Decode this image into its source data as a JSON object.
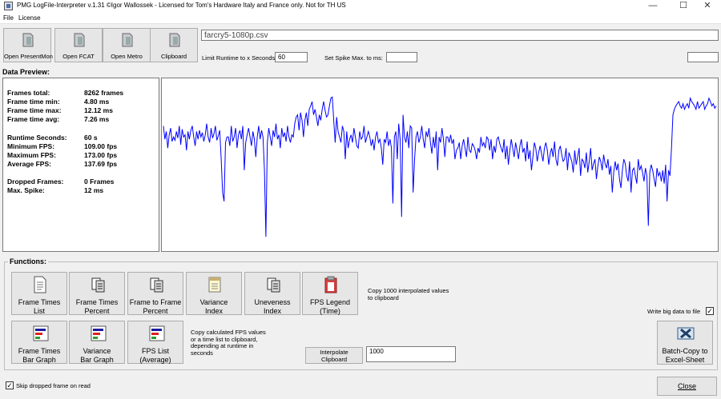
{
  "window": {
    "title": "PMG LogFile-Interpreter v.1.31 ©Igor Wallossek - Licensed for Tom's Hardware Italy and France only. Not for TH US",
    "minimize_glyph": "—",
    "maximize_glyph": "☐",
    "close_glyph": "✕"
  },
  "menu": {
    "file": "File",
    "license": "License"
  },
  "toolbar": {
    "open_presentmon": "Open PresentMon",
    "open_fcat": "Open FCAT",
    "open_metro": "Open Metro",
    "clipboard": "Clipboard"
  },
  "filename": "farcry5-1080p.csv",
  "limit_runtime": {
    "label": "Limit Runtime to x Seconds:",
    "value": "60"
  },
  "spike": {
    "label": "Set Spike Max. to ms:",
    "value": ""
  },
  "extra_field": "",
  "preview_label": "Data Preview:",
  "stats": {
    "frames_total_label": "Frames total:",
    "frames_total": "8262 frames",
    "ft_min_label": "Frame time min:",
    "ft_min": "4.80 ms",
    "ft_max_label": "Frame time max:",
    "ft_max": "12.12 ms",
    "ft_avg_label": "Frame time avg:",
    "ft_avg": "7.26 ms",
    "runtime_label": "Runtime Seconds:",
    "runtime": "60 s",
    "min_fps_label": "Minimum FPS:",
    "min_fps": "109.00 fps",
    "max_fps_label": "Maximum FPS:",
    "max_fps": "173.00 fps",
    "avg_fps_label": "Average FPS:",
    "avg_fps": "137.69 fps",
    "dropped_label": "Dropped Frames:",
    "dropped": "0 Frames",
    "spike_label": "Max. Spike:",
    "spike": "12 ms"
  },
  "functions": {
    "group_label": "Functions:",
    "frame_times_list": [
      "Frame Times",
      "List"
    ],
    "frame_times_percent": [
      "Frame Times",
      "Percent"
    ],
    "frame_to_frame_percent": [
      "Frame to Frame",
      "Percent"
    ],
    "variance_index": [
      "Variance",
      "Index"
    ],
    "uneveness_index": [
      "Uneveness",
      "Index"
    ],
    "fps_legend": [
      "FPS Legend",
      "(Time)"
    ],
    "frame_times_bar": [
      "Frame Times",
      "Bar Graph"
    ],
    "variance_bar": [
      "Variance",
      "Bar Graph"
    ],
    "fps_list_avg": [
      "FPS List",
      "(Average)"
    ],
    "copy_1000_note": [
      "Copy 1000 interpolated values",
      "to clipboard"
    ],
    "copy_calc_note": [
      "Copy calculated FPS values",
      "or a time list to clipboard,",
      "depending at runtime in",
      "seconds"
    ],
    "interpolate": [
      "Interpolate",
      "Clipboard"
    ],
    "interpolate_value": "1000",
    "write_big_label": "Write big data to file",
    "write_big_checked": "✓",
    "batch_copy": [
      "Batch-Copy to",
      "Excel-Sheet"
    ]
  },
  "skip_dropped": {
    "label": "Skip dropped frame on read",
    "checked": "✓"
  },
  "close": "Close",
  "colors": {
    "trace": "#0000ff",
    "red": "#e02020",
    "blue": "#1a1aa0",
    "green": "#2aa02a"
  },
  "chart_data": {
    "type": "line",
    "title": "",
    "series": [
      {
        "values": [
          160,
          148,
          155,
          140,
          152,
          158,
          146,
          150,
          147,
          155,
          149,
          160,
          143,
          157,
          150,
          152,
          138,
          155,
          148,
          156,
          160,
          150,
          142,
          155,
          148,
          156,
          150,
          154,
          146,
          152,
          162,
          150,
          145,
          158,
          149,
          153,
          160,
          147,
          151,
          156,
          130,
          100,
          92,
          145,
          150,
          150,
          142,
          160,
          146,
          150,
          158,
          140,
          152,
          156,
          148,
          160,
          120,
          145,
          152,
          158,
          150,
          142,
          155,
          148,
          132,
          150,
          160,
          148,
          156,
          150,
          120,
          60,
          145,
          158,
          150,
          142,
          156,
          150,
          162,
          148,
          152,
          140,
          158,
          150,
          154,
          146,
          160,
          150,
          145,
          152,
          150,
          162,
          168,
          170,
          156,
          172,
          165,
          150,
          165,
          172,
          160,
          175,
          178,
          182,
          170,
          175,
          168,
          160,
          170,
          165,
          175,
          182,
          174,
          168,
          170,
          178,
          185,
          186,
          165,
          145,
          168,
          155,
          150,
          145,
          160,
          155,
          130,
          155,
          140,
          148,
          152,
          145,
          158,
          150,
          142,
          140,
          155,
          148,
          150,
          160,
          145,
          150,
          155,
          150,
          142,
          148,
          138,
          150,
          155,
          145,
          148,
          140,
          125,
          148,
          145,
          155,
          142,
          148,
          140,
          90,
          150,
          155,
          130,
          162,
          148,
          78,
          170,
          150,
          145,
          155,
          140,
          160,
          158,
          100,
          130,
          150,
          155,
          145,
          150,
          160,
          148,
          140,
          155,
          150,
          158,
          145,
          135,
          150,
          140,
          155,
          120,
          150,
          145,
          158,
          148,
          132,
          150,
          150,
          145,
          152,
          144,
          148,
          130,
          138,
          140,
          145,
          130,
          142,
          148,
          140,
          132,
          150,
          138,
          136,
          144,
          142,
          138,
          130,
          140,
          136,
          150,
          142,
          145,
          140,
          150,
          148,
          138,
          148,
          130,
          142,
          136,
          148,
          150,
          144,
          140,
          136,
          148,
          130,
          142,
          125,
          138,
          148,
          140,
          132,
          145,
          138,
          130,
          142,
          148,
          136,
          140,
          128,
          146,
          130,
          138,
          120,
          132,
          145,
          140,
          128,
          136,
          142,
          135,
          128,
          140,
          145,
          138,
          125,
          135,
          140,
          132,
          146,
          130,
          124,
          138,
          142,
          134,
          128,
          130,
          140,
          120,
          136,
          132,
          128,
          118,
          138,
          125,
          132,
          140,
          115,
          130,
          128,
          122,
          136,
          118,
          128,
          140,
          120,
          126,
          130,
          112,
          124,
          132,
          128,
          120,
          134,
          126,
          122,
          130,
          116,
          124,
          100,
          118,
          128,
          120,
          126,
          112,
          104,
          120,
          130,
          126,
          115,
          110,
          128,
          100,
          120,
          122,
          115,
          108,
          130,
          120,
          124,
          118,
          110,
          122,
          115,
          70,
          118,
          125,
          120,
          112,
          105,
          122,
          115,
          118,
          110,
          120,
          108,
          125,
          92,
          120,
          115,
          140,
          170,
          175,
          178,
          180,
          182,
          178,
          176,
          180,
          175,
          178,
          180,
          176,
          185,
          182,
          180,
          178,
          175,
          182,
          176,
          178,
          180,
          182,
          175,
          178,
          180,
          185,
          182,
          178,
          180,
          176,
          178
        ]
      }
    ],
    "ylim": [
      50,
      200
    ]
  }
}
